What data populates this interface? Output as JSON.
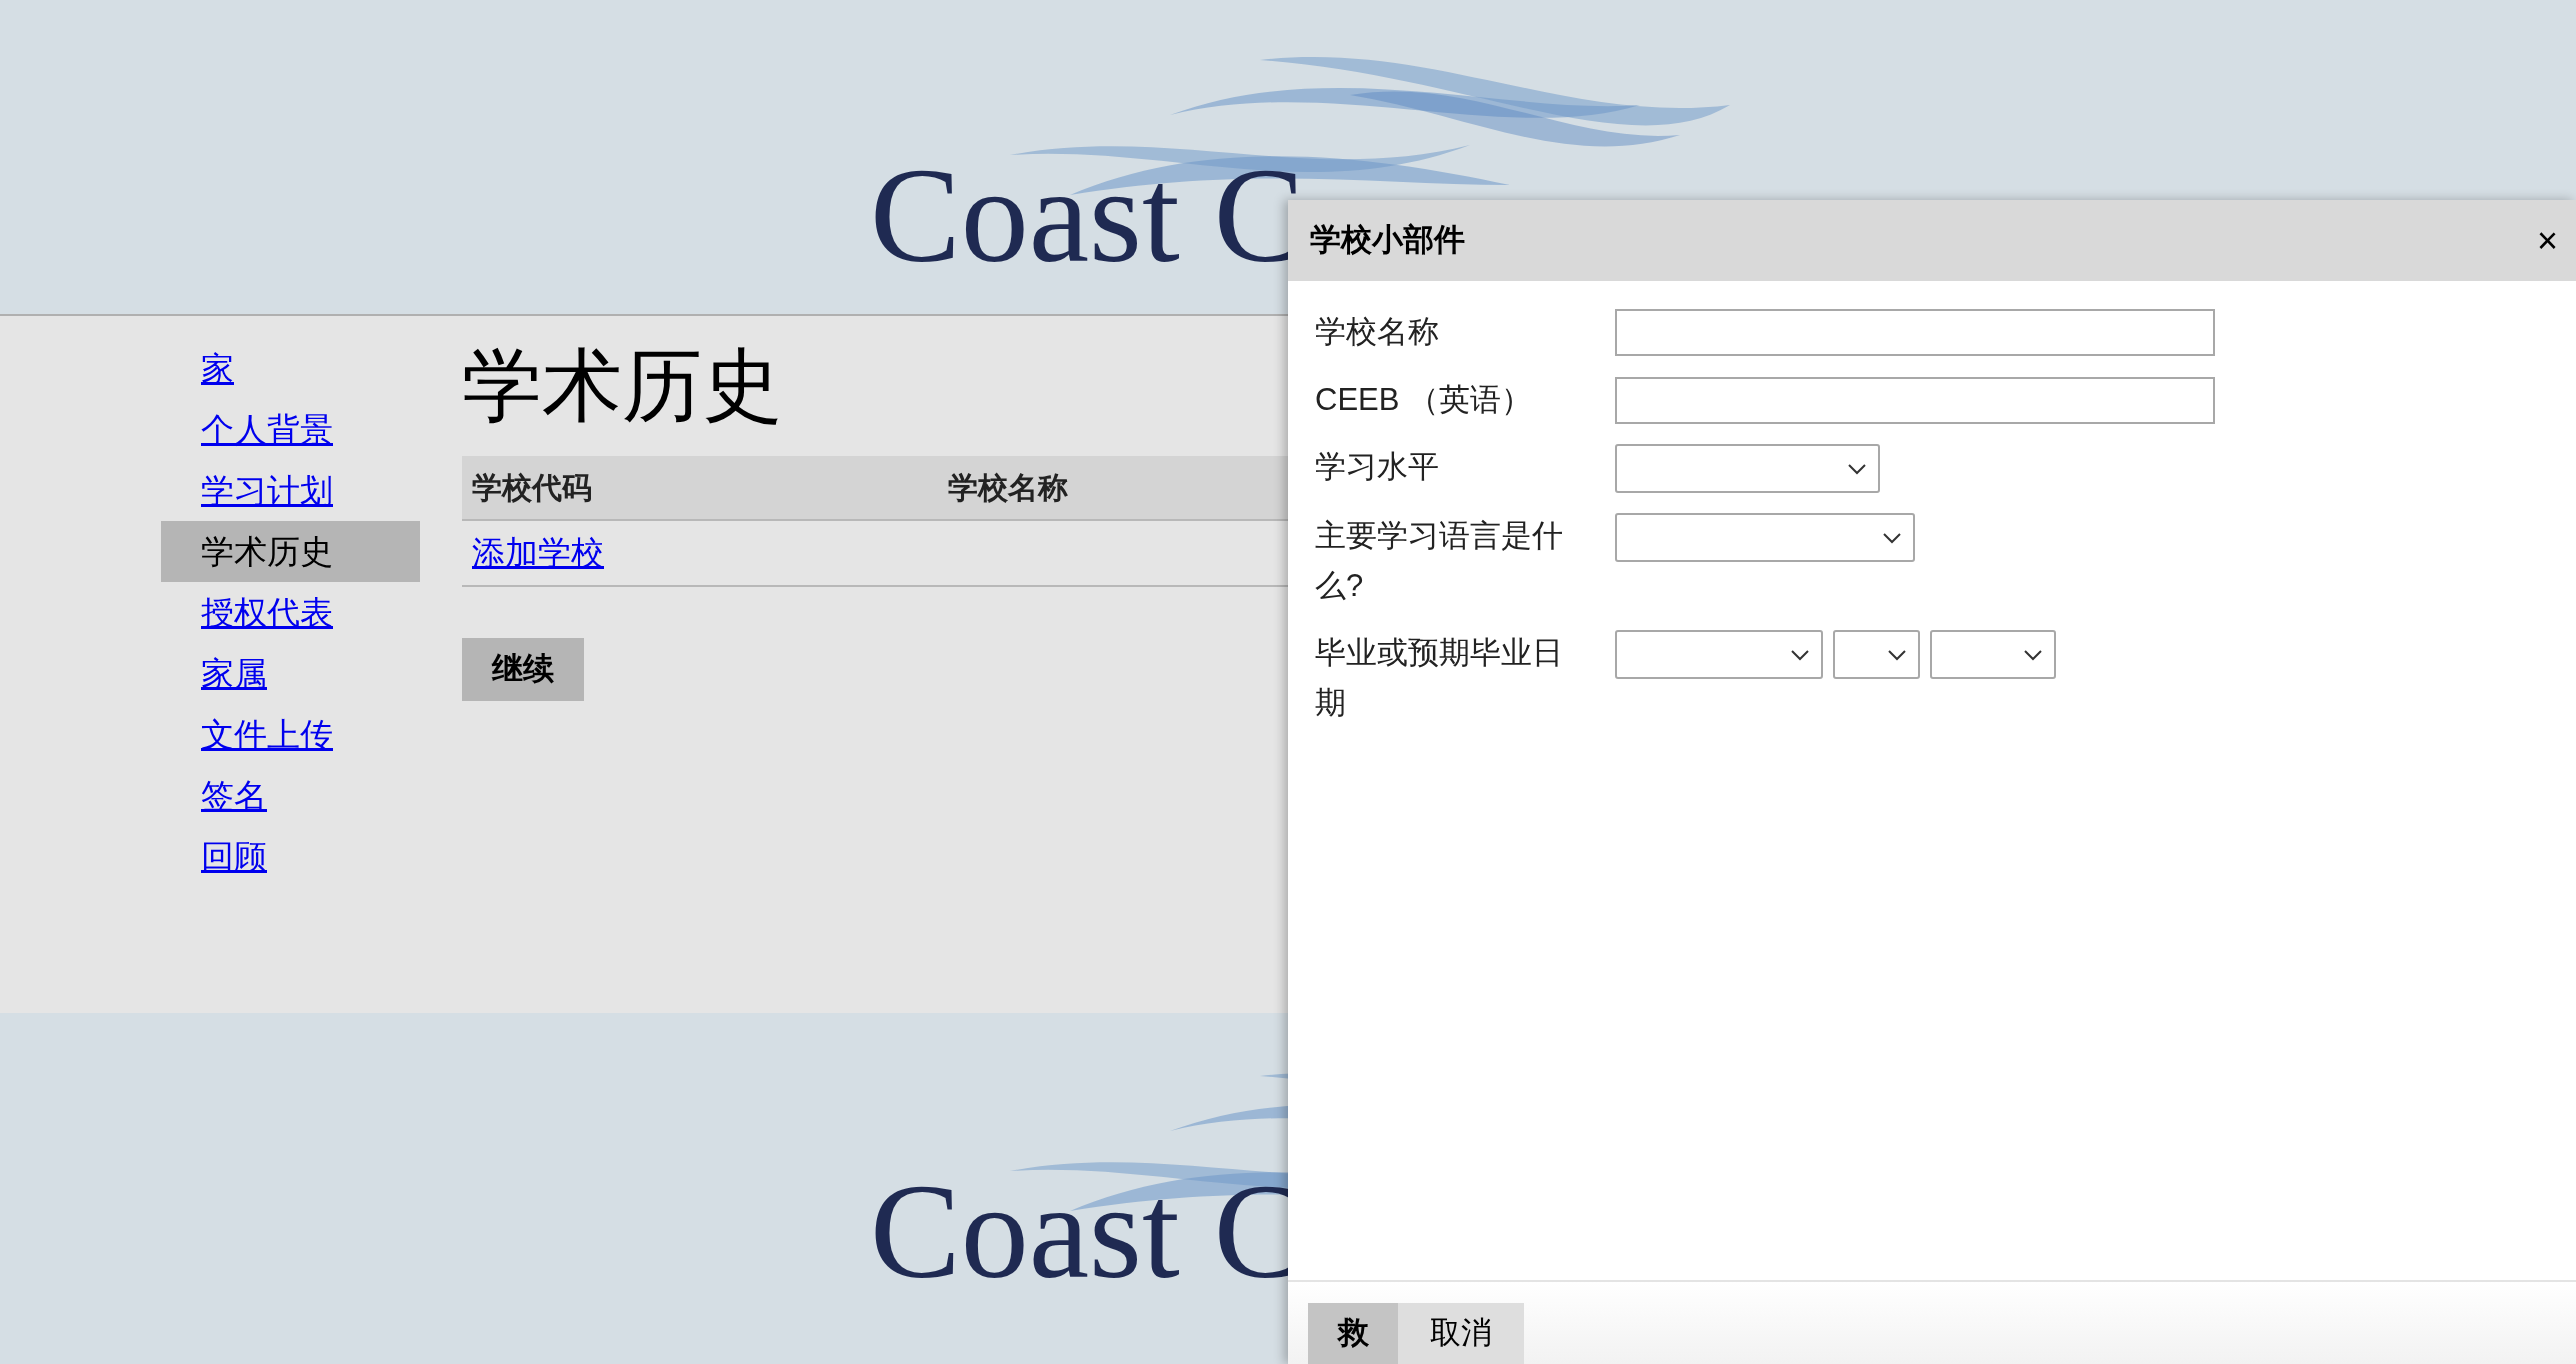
{
  "header": {
    "logo_text": "Coast C"
  },
  "nav": {
    "items": [
      {
        "label": "家",
        "selected": false
      },
      {
        "label": "个人背景",
        "selected": false
      },
      {
        "label": "学习计划",
        "selected": false
      },
      {
        "label": "学术历史",
        "selected": true
      },
      {
        "label": "授权代表",
        "selected": false
      },
      {
        "label": "家属",
        "selected": false
      },
      {
        "label": "文件上传",
        "selected": false
      },
      {
        "label": "签名",
        "selected": false
      },
      {
        "label": "回顾",
        "selected": false
      }
    ]
  },
  "page": {
    "title": "学术历史",
    "table": {
      "columns": [
        "学校代码",
        "学校名称"
      ],
      "add_link": "添加学校"
    },
    "continue_button": "继续"
  },
  "footer": {
    "logo_text": "Coast C"
  },
  "dialog": {
    "title": "学校小部件",
    "close": "×",
    "fields": [
      {
        "label": "学校名称",
        "kind": "text"
      },
      {
        "label": "CEEB （英语）",
        "kind": "text"
      },
      {
        "label": "学习水平",
        "kind": "select"
      },
      {
        "label": "主要学习语言是什么?",
        "kind": "select"
      },
      {
        "label": "毕业或预期毕业日期",
        "kind": "date"
      }
    ],
    "buttons": [
      {
        "label": "救",
        "kind": "primary"
      },
      {
        "label": "取消",
        "kind": "secondary"
      }
    ]
  }
}
